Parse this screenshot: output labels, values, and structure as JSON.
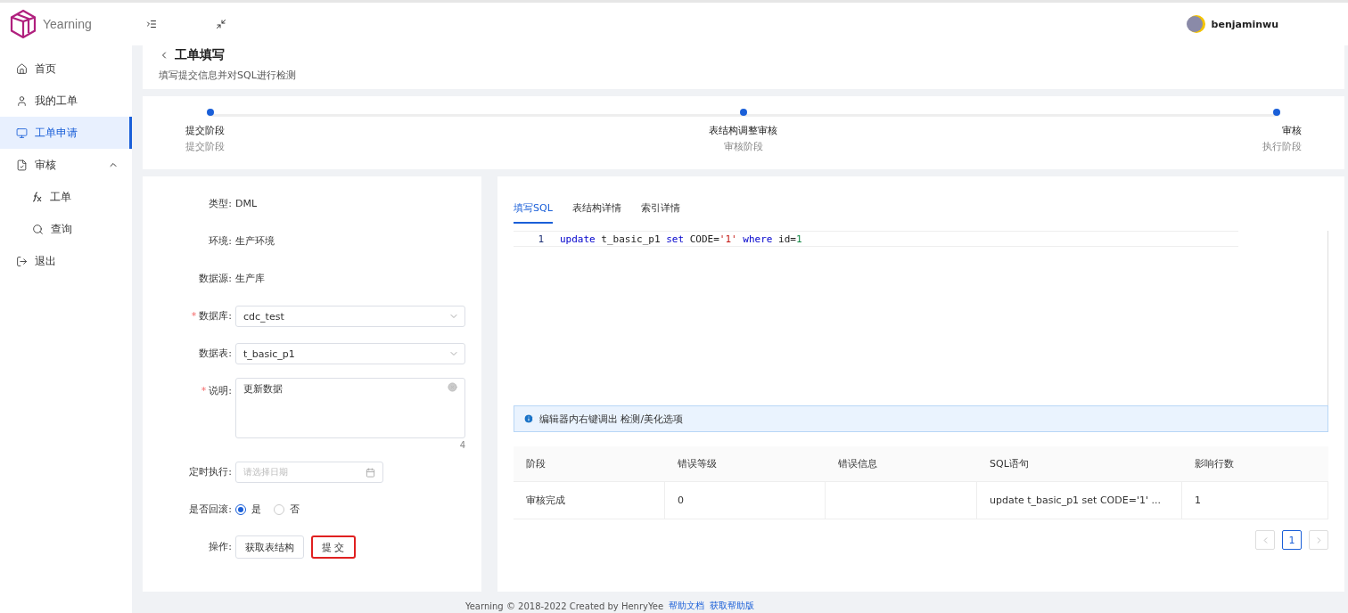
{
  "brand": {
    "name": "Yearning"
  },
  "user": {
    "name": "benjaminwu"
  },
  "sidebar": {
    "items": [
      {
        "kind": "home",
        "label": "首页",
        "selected": false
      },
      {
        "kind": "user",
        "label": "我的工单",
        "selected": false
      },
      {
        "kind": "monitor",
        "label": "工单申请",
        "selected": true
      },
      {
        "kind": "audit",
        "label": "审核",
        "selected": false,
        "expanded": true,
        "children": [
          {
            "kind": "fx",
            "label": "工单",
            "selected": false
          },
          {
            "kind": "search",
            "label": "查询",
            "selected": false
          }
        ]
      },
      {
        "kind": "logout",
        "label": "退出",
        "selected": false
      }
    ]
  },
  "page_header": {
    "title": "工单填写",
    "subtitle": "填写提交信息并对SQL进行检测"
  },
  "steps": [
    {
      "title": "提交阶段",
      "description": "提交阶段"
    },
    {
      "title": "表结构调整审核",
      "description": "审核阶段"
    },
    {
      "title": "审核",
      "description": "执行阶段"
    }
  ],
  "form": [
    {
      "kind": "text",
      "label": "类型:",
      "value": "DML"
    },
    {
      "kind": "text",
      "label": "环境:",
      "value": "生产环境"
    },
    {
      "kind": "text",
      "label": "数据源:",
      "value": "生产库"
    },
    {
      "kind": "select",
      "label": "数据库:",
      "required": true,
      "required_mark": "*",
      "value": "cdc_test"
    },
    {
      "kind": "select",
      "label": "数据表:",
      "value": "t_basic_p1"
    },
    {
      "kind": "textarea",
      "label": "说明:",
      "required": true,
      "required_mark": "*",
      "value": "更新数据",
      "count": "4"
    },
    {
      "kind": "date",
      "label": "定时执行:",
      "placeholder": "请选择日期"
    },
    {
      "kind": "radio",
      "label": "是否回滚:",
      "options": [
        {
          "label": "是",
          "selected": true
        },
        {
          "label": "否",
          "selected": false
        }
      ]
    },
    {
      "kind": "buttons",
      "label": "操作:",
      "buttons": [
        {
          "label": "获取表结构",
          "highlighted": false
        },
        {
          "label": "提 交",
          "highlighted": true
        }
      ]
    }
  ],
  "tabs": [
    {
      "label": "填写SQL",
      "selected": true
    },
    {
      "label": "表结构详情",
      "selected": false
    },
    {
      "label": "索引详情",
      "selected": false
    }
  ],
  "editor": {
    "lines": [
      {
        "number": "1",
        "tokens": [
          {
            "kind": "keyword",
            "text": "update"
          },
          {
            "kind": "plain",
            "text": " t_basic_p1 "
          },
          {
            "kind": "keyword",
            "text": "set"
          },
          {
            "kind": "plain",
            "text": " CODE="
          },
          {
            "kind": "string",
            "text": "'1'"
          },
          {
            "kind": "keyword",
            "text": " where"
          },
          {
            "kind": "plain",
            "text": " id="
          },
          {
            "kind": "number",
            "text": "1"
          }
        ]
      }
    ]
  },
  "hint": "编辑器内右键调出 检测/美化选项",
  "table": {
    "columns": [
      "阶段",
      "错误等级",
      "错误信息",
      "SQL语句",
      "影响行数"
    ],
    "rows": [
      [
        "审核完成",
        "0",
        "",
        "update t_basic_p1 set CODE='1' ...",
        "1"
      ]
    ]
  },
  "pagination": {
    "pages": [
      {
        "label": "1",
        "selected": true
      }
    ]
  },
  "footer": {
    "text": "Yearning © 2018-2022 Created by HenryYee",
    "links": [
      "帮助文档",
      "获取帮助版"
    ]
  }
}
